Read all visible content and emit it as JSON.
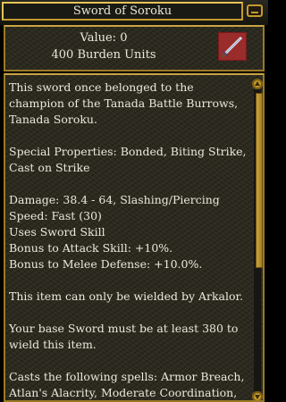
{
  "window": {
    "title": "Sword of Soroku"
  },
  "item": {
    "value_text": "Value: 0",
    "burden_text": "400 Burden Units",
    "icon": "sword-icon"
  },
  "description": {
    "paragraphs": [
      "This sword once belonged to the champion of the Tanada Battle Burrows, Tanada Soroku.",
      "Special Properties: Bonded, Biting Strike, Cast on Strike",
      "Damage: 38.4 - 64, Slashing/Piercing\nSpeed: Fast (30)\nUses Sword Skill\nBonus to Attack Skill: +10%.\nBonus to Melee Defense: +10.0%.",
      "This item can only be wielded by Arkalor.",
      "Your base Sword must be at least 380 to wield this item.",
      "Casts the following spells: Armor Breach, Atlan's Alacrity, Moderate Coordination,"
    ]
  },
  "colors": {
    "frame_gold": "#c49a2e",
    "panel_bg": "#2c2a1f",
    "text": "#ece8da"
  },
  "scrollbar": {
    "position_fraction": 0
  }
}
